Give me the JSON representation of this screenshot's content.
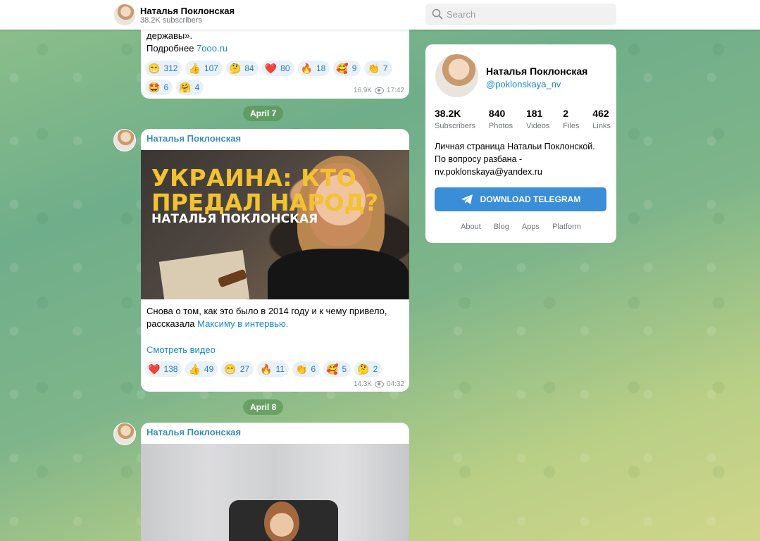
{
  "header": {
    "channel_title": "Наталья Поклонская",
    "subscribers": "38.2K subscribers",
    "search_placeholder": "Search"
  },
  "messages": [
    {
      "text_line1": "державы».",
      "text_line2_prefix": "Подробнее ",
      "link": "7ooo.ru",
      "reactions": [
        {
          "emoji": "😁",
          "count": "312"
        },
        {
          "emoji": "👍",
          "count": "107"
        },
        {
          "emoji": "🤔",
          "count": "84"
        },
        {
          "emoji": "❤️",
          "count": "80"
        },
        {
          "emoji": "🔥",
          "count": "18"
        },
        {
          "emoji": "🥰",
          "count": "9"
        },
        {
          "emoji": "👏",
          "count": "7"
        },
        {
          "emoji": "🤩",
          "count": "6"
        },
        {
          "emoji": "🤗",
          "count": "4"
        }
      ],
      "views": "16.9K",
      "time": "17:42"
    },
    {
      "date": "April 7",
      "author": "Наталья Поклонская",
      "thumb_line1": "УКРАИНА: КТО",
      "thumb_line2": "ПРЕДАЛ НАРОД?",
      "thumb_line3": "НАТАЛЬЯ ПОКЛОНСКАЯ",
      "text_line1": "Снова о том, как это было в 2014 году и к чему привело,",
      "text_line2_prefix": "рассказала ",
      "link": "Максиму в интервью.",
      "video_link": "Смотреть видео",
      "reactions": [
        {
          "emoji": "❤️",
          "count": "138"
        },
        {
          "emoji": "👍",
          "count": "49"
        },
        {
          "emoji": "😁",
          "count": "27"
        },
        {
          "emoji": "🔥",
          "count": "11"
        },
        {
          "emoji": "👏",
          "count": "6"
        },
        {
          "emoji": "🥰",
          "count": "5"
        },
        {
          "emoji": "🤔",
          "count": "2"
        }
      ],
      "views": "14.3K",
      "time": "04:32"
    },
    {
      "date": "April 8",
      "author": "Наталья Поклонская"
    }
  ],
  "profile": {
    "name": "Наталья Поклонская",
    "handle": "@poklonskaya_nv",
    "stats": [
      {
        "value": "38.2K",
        "label": "Subscribers"
      },
      {
        "value": "840",
        "label": "Photos"
      },
      {
        "value": "181",
        "label": "Videos"
      },
      {
        "value": "2",
        "label": "Files"
      },
      {
        "value": "462",
        "label": "Links"
      }
    ],
    "desc_line1": "Личная страница Натальи Поклонской.",
    "desc_line2": "По вопросу разбана -",
    "desc_line3": "nv.poklonskaya@yandex.ru",
    "download_label": "DOWNLOAD TELEGRAM",
    "footer_links": [
      "About",
      "Blog",
      "Apps",
      "Platform"
    ]
  },
  "colors": {
    "accent": "#168acd",
    "button": "#3a8ed8",
    "author": "#3a8fb0"
  }
}
